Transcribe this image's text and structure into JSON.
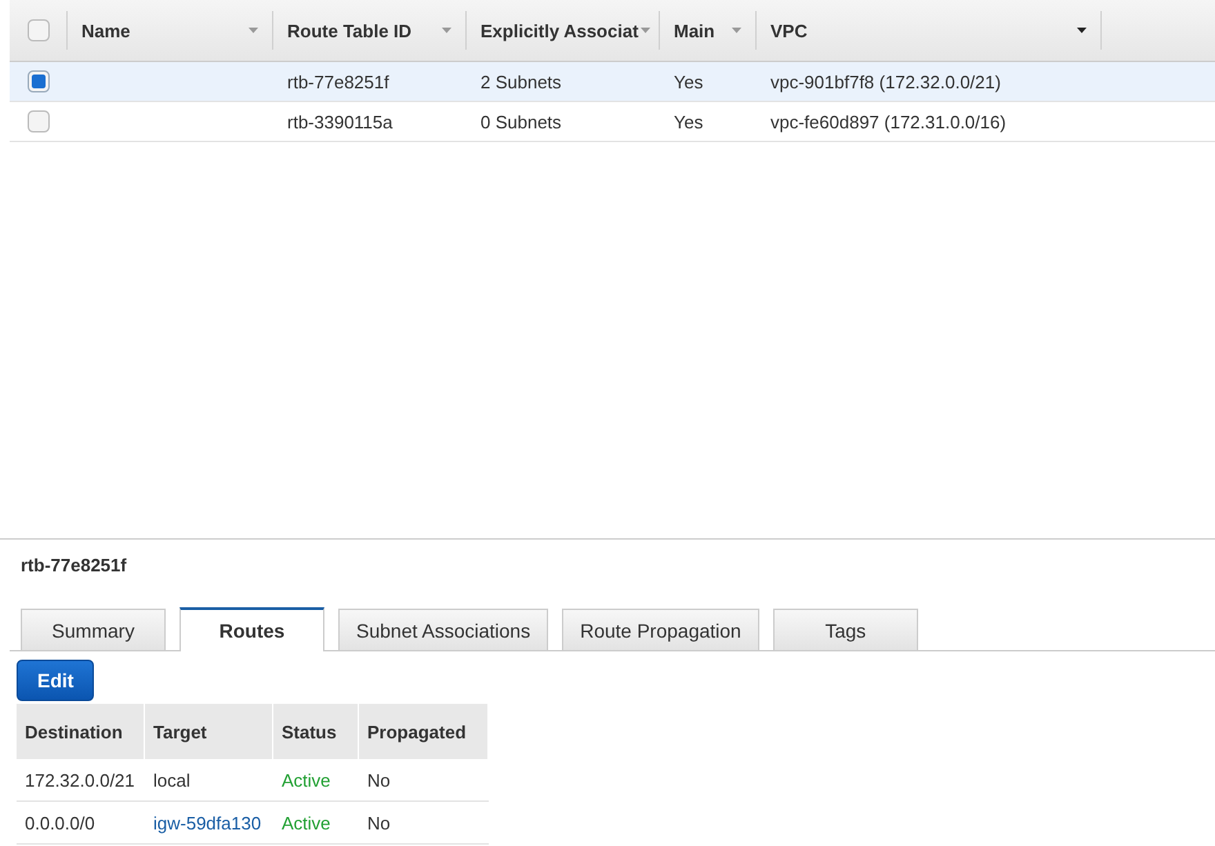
{
  "table": {
    "select_all": {
      "checked": false
    },
    "columns": [
      {
        "label": "Name",
        "sorted": false
      },
      {
        "label": "Route Table ID",
        "sorted": false
      },
      {
        "label": "Explicitly Associat",
        "sorted": false
      },
      {
        "label": "Main",
        "sorted": false
      },
      {
        "label": "VPC",
        "sorted": true
      }
    ],
    "rows": [
      {
        "selected": true,
        "cells": [
          "",
          "rtb-77e8251f",
          "2 Subnets",
          "Yes",
          "vpc-901bf7f8 (172.32.0.0/21)"
        ]
      },
      {
        "selected": false,
        "cells": [
          "",
          "rtb-3390115a",
          "0 Subnets",
          "Yes",
          "vpc-fe60d897 (172.31.0.0/16)"
        ]
      }
    ]
  },
  "details": {
    "title": "rtb-77e8251f",
    "tabs": [
      {
        "label": "Summary",
        "selected": false
      },
      {
        "label": "Routes",
        "selected": true
      },
      {
        "label": "Subnet Associations",
        "selected": false
      },
      {
        "label": "Route Propagation",
        "selected": false
      },
      {
        "label": "Tags",
        "selected": false
      }
    ],
    "edit_button": "Edit",
    "routes": {
      "columns": [
        "Destination",
        "Target",
        "Status",
        "Propagated"
      ],
      "rows": [
        {
          "destination": "172.32.0.0/21",
          "target": "local",
          "kind": "text",
          "status": "Active",
          "propagated": "No"
        },
        {
          "destination": "0.0.0.0/0",
          "target": "igw-59dfa130",
          "kind": "link",
          "status": "Active",
          "propagated": "No"
        }
      ]
    }
  }
}
